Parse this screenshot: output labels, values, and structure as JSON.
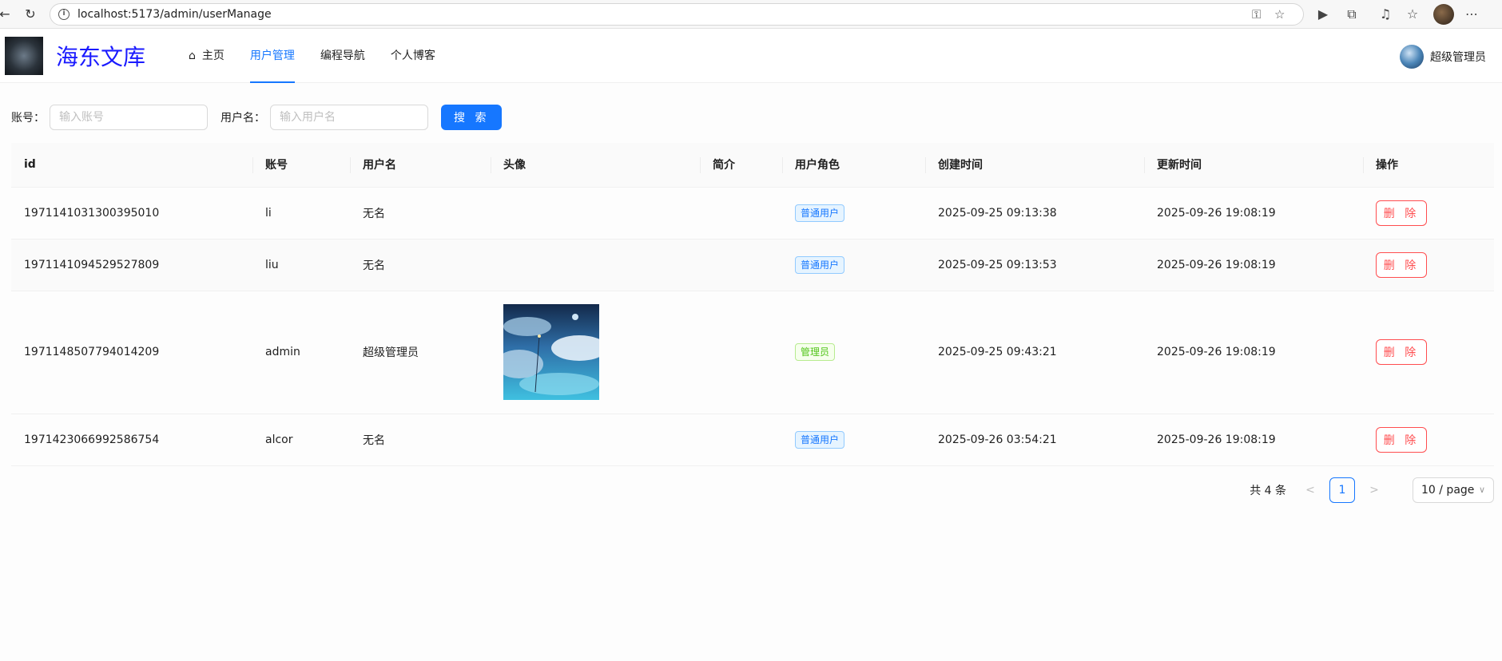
{
  "browser": {
    "url": "localhost:5173/admin/userManage"
  },
  "header": {
    "brand": "海东文库",
    "nav": [
      {
        "label": "主页",
        "icon": "home-icon"
      },
      {
        "label": "用户管理"
      },
      {
        "label": "编程导航"
      },
      {
        "label": "个人博客"
      }
    ],
    "user_name": "超级管理员"
  },
  "search": {
    "account_label": "账号：",
    "account_placeholder": "输入账号",
    "username_label": "用户名：",
    "username_placeholder": "输入用户名",
    "search_button": "搜 索"
  },
  "table": {
    "columns": [
      "id",
      "账号",
      "用户名",
      "头像",
      "简介",
      "用户角色",
      "创建时间",
      "更新时间",
      "操作"
    ],
    "rows": [
      {
        "id": "1971141031300395010",
        "account": "li",
        "username": "无名",
        "role": "普通用户",
        "created": "2025-09-25 09:13:38",
        "updated": "2025-09-26 19:08:19",
        "action": "删 除"
      },
      {
        "id": "1971141094529527809",
        "account": "liu",
        "username": "无名",
        "role": "普通用户",
        "created": "2025-09-25 09:13:53",
        "updated": "2025-09-26 19:08:19",
        "action": "删 除"
      },
      {
        "id": "1971148507794014209",
        "account": "admin",
        "username": "超级管理员",
        "role": "管理员",
        "created": "2025-09-25 09:43:21",
        "updated": "2025-09-26 19:08:19",
        "action": "删 除"
      },
      {
        "id": "1971423066992586754",
        "account": "alcor",
        "username": "无名",
        "role": "普通用户",
        "created": "2025-09-26 03:54:21",
        "updated": "2025-09-26 19:08:19",
        "action": "删 除"
      }
    ]
  },
  "pagination": {
    "total": "共 4 条",
    "current_page": "1",
    "page_size": "10 / page"
  },
  "colors": {
    "primary": "#1677ff",
    "danger": "#ff4d4f",
    "brand": "#1a1aff",
    "tag_green": "#52c41a"
  }
}
